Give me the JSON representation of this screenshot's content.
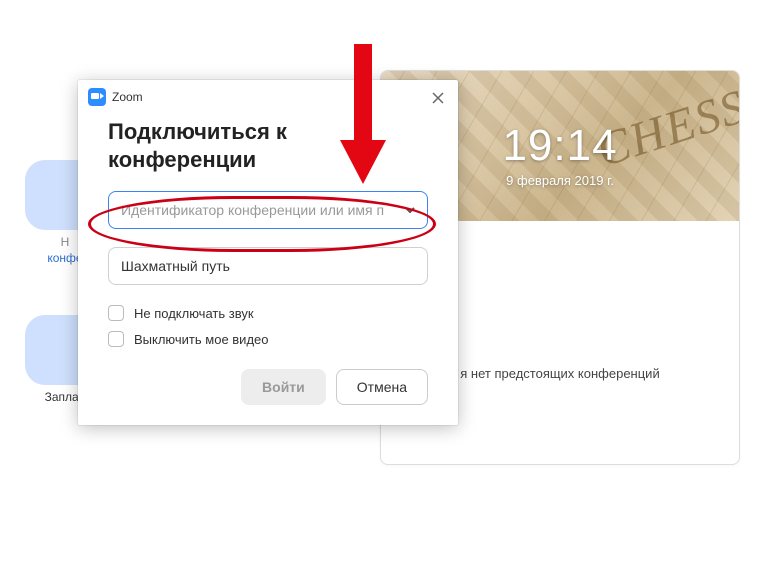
{
  "sidebar": {
    "new_a": "Н",
    "new_b": "конфе",
    "scheduled_a": "Заплан",
    "scheduled_b": ""
  },
  "banner": {
    "decor_text": "CHESS",
    "time": "19:14",
    "date": "9 февраля 2019 г."
  },
  "main": {
    "no_meetings": "я нет предстоящих конференций"
  },
  "dialog": {
    "app_name": "Zoom",
    "heading": "Подключиться к конференции",
    "id_placeholder": "Идентификатор конференции или имя п",
    "display_name": "Шахматный путь",
    "opt_no_audio": "Не подключать звук",
    "opt_no_video": "Выключить мое видео",
    "join_label": "Войти",
    "cancel_label": "Отмена"
  }
}
